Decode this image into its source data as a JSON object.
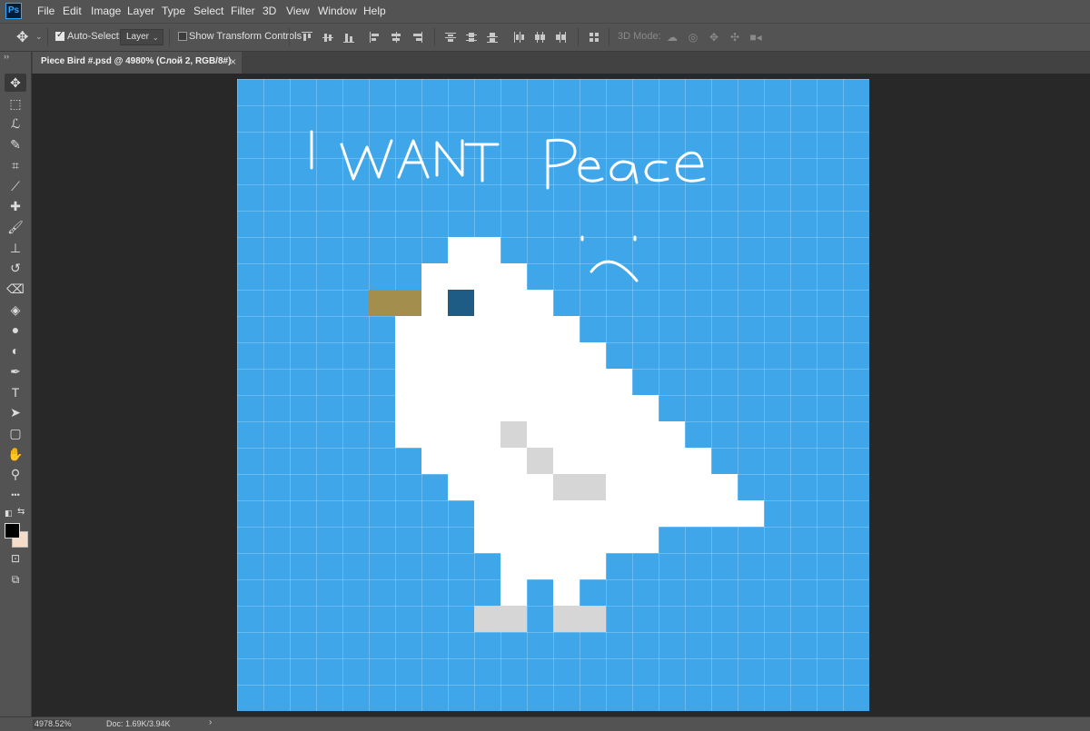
{
  "app": {
    "logo": "Ps"
  },
  "menu": [
    "File",
    "Edit",
    "Image",
    "Layer",
    "Type",
    "Select",
    "Filter",
    "3D",
    "View",
    "Window",
    "Help"
  ],
  "options": {
    "move_icon": "move-icon",
    "auto_select_label": "Auto-Select:",
    "auto_select_checked": true,
    "auto_select_target": "Layer",
    "show_transform_label": "Show Transform Controls",
    "show_transform_checked": false,
    "mode_3d_label": "3D Mode:"
  },
  "tab": {
    "title": "Piece Bird #.psd @ 4980% (Слой 2, RGB/8#)",
    "close": "×"
  },
  "toolbar": {
    "collapse": "››",
    "tools": [
      {
        "name": "move-tool",
        "icon": "move-icon",
        "glyph": "✥"
      },
      {
        "name": "marquee-tool",
        "icon": "rectangular-marquee-icon",
        "glyph": "⬚"
      },
      {
        "name": "lasso-tool",
        "icon": "polygonal-lasso-icon",
        "glyph": "ℒ"
      },
      {
        "name": "quick-select-tool",
        "icon": "quick-selection-icon",
        "glyph": "✎"
      },
      {
        "name": "crop-tool",
        "icon": "crop-icon",
        "glyph": "⌗"
      },
      {
        "name": "eyedropper-tool",
        "icon": "eyedropper-icon",
        "glyph": "⟋"
      },
      {
        "name": "healing-tool",
        "icon": "healing-brush-icon",
        "glyph": "✚"
      },
      {
        "name": "brush-tool",
        "icon": "brush-icon",
        "glyph": "🖌"
      },
      {
        "name": "stamp-tool",
        "icon": "clone-stamp-icon",
        "glyph": "⊥"
      },
      {
        "name": "history-brush-tool",
        "icon": "history-brush-icon",
        "glyph": "↺"
      },
      {
        "name": "eraser-tool",
        "icon": "eraser-icon",
        "glyph": "⌫"
      },
      {
        "name": "paint-bucket-tool",
        "icon": "paint-bucket-icon",
        "glyph": "◈"
      },
      {
        "name": "blur-tool",
        "icon": "blur-drop-icon",
        "glyph": "●"
      },
      {
        "name": "dodge-tool",
        "icon": "dodge-icon",
        "glyph": "◐"
      },
      {
        "name": "pen-tool",
        "icon": "pen-icon",
        "glyph": "✒"
      },
      {
        "name": "type-tool",
        "icon": "type-icon",
        "glyph": "T"
      },
      {
        "name": "path-select-tool",
        "icon": "path-selection-icon",
        "glyph": "➤"
      },
      {
        "name": "shape-tool",
        "icon": "rectangle-shape-icon",
        "glyph": "▢"
      },
      {
        "name": "hand-tool",
        "icon": "hand-icon",
        "glyph": "✋"
      },
      {
        "name": "zoom-tool",
        "icon": "zoom-icon",
        "glyph": "⚲"
      },
      {
        "name": "more-tools",
        "icon": "more-icon",
        "glyph": "•••"
      }
    ]
  },
  "colors": {
    "foreground": "#000000",
    "background": "#f5dcc8",
    "canvas_bg": "#3fa6ea",
    "bird": "#ffffff",
    "wing": "#d6d6d6",
    "beak": "#a48e4e",
    "eye": "#1e5c86"
  },
  "status": {
    "zoom": "4978.52%",
    "doc": "Doc: 1.69K/3.94K",
    "arrow": "›"
  },
  "canvas": {
    "handwriting_1": "I WANT",
    "handwriting_2": "Peace"
  }
}
